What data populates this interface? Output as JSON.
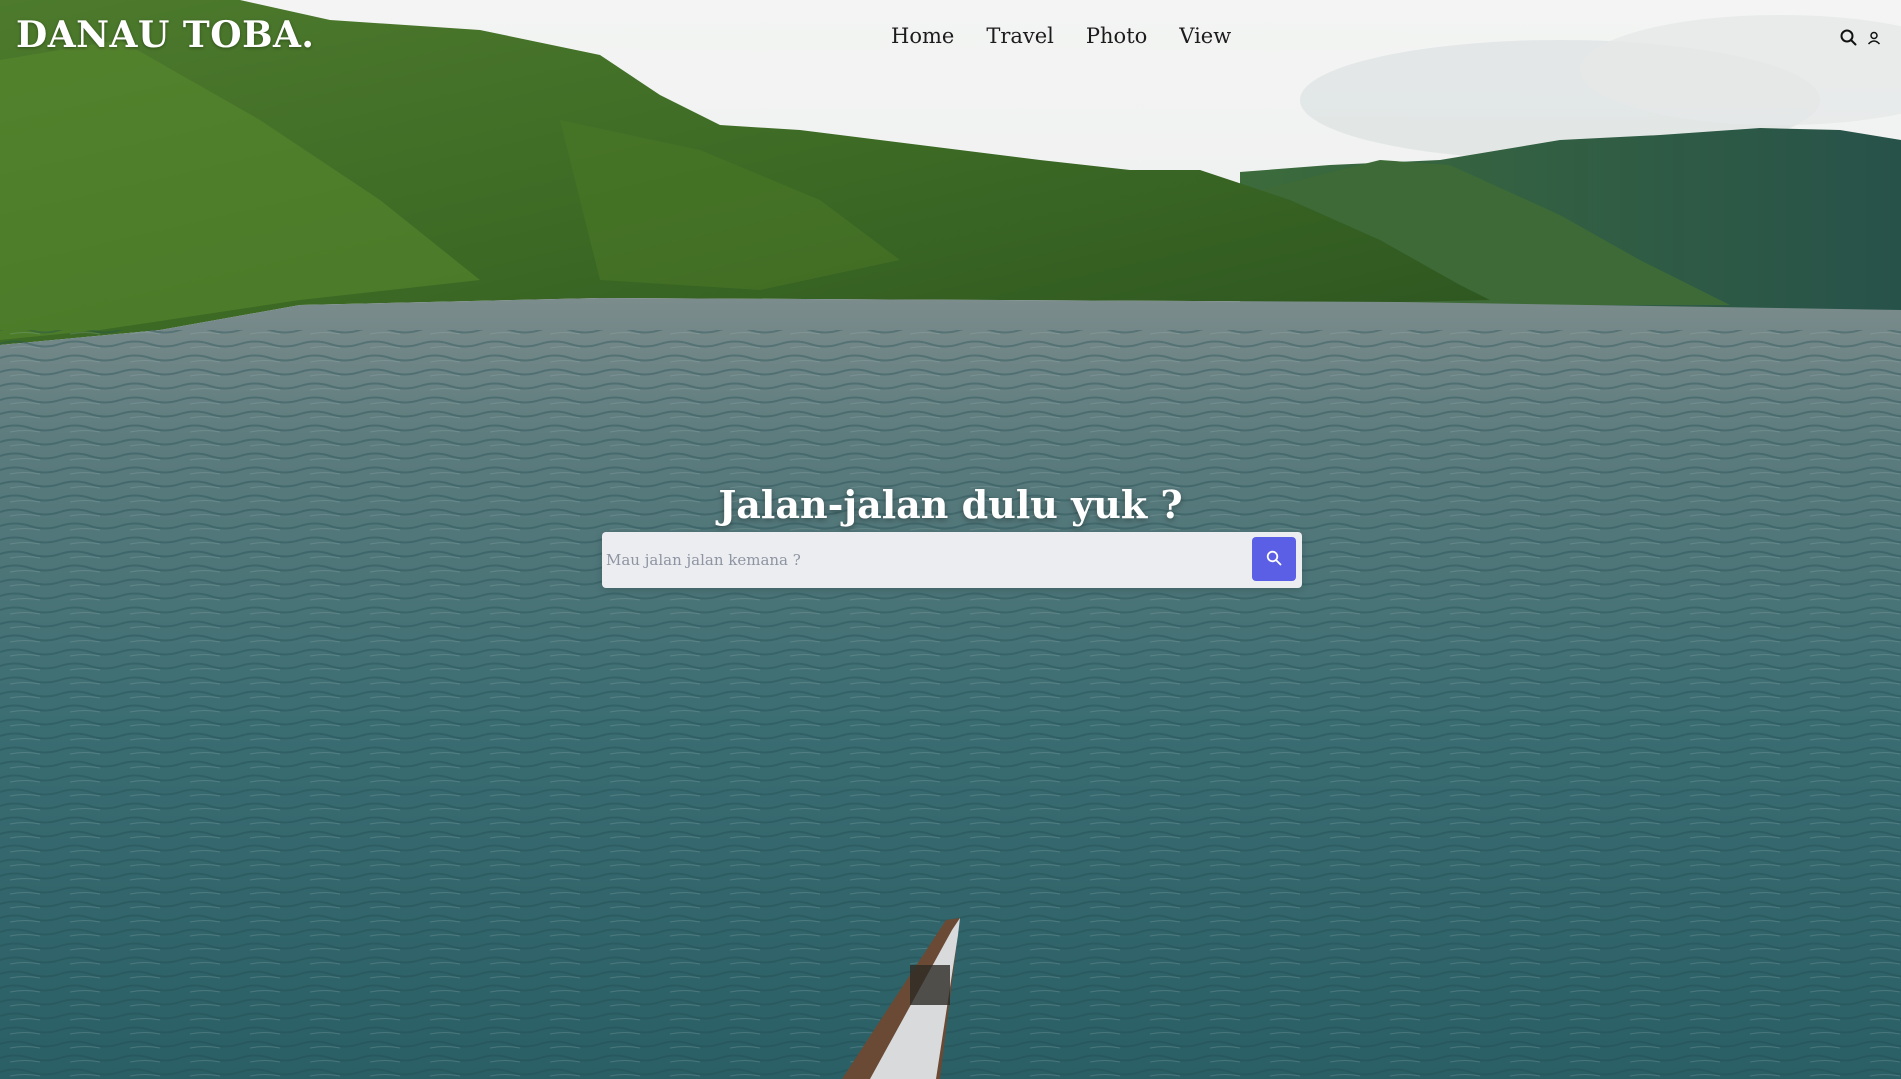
{
  "brand": {
    "logo": "DANAU TOBA."
  },
  "nav": {
    "links": [
      {
        "label": "Home"
      },
      {
        "label": "Travel"
      },
      {
        "label": "Photo"
      },
      {
        "label": "View"
      }
    ],
    "icons": [
      "search-icon",
      "user-icon"
    ]
  },
  "hero": {
    "title": "Jalan-jalan dulu yuk ?",
    "search": {
      "placeholder": "Mau jalan jalan kemana ?",
      "value": "",
      "button_icon": "search-icon"
    }
  },
  "colors": {
    "accent": "#5b5fe6",
    "water": "#2f6b72",
    "hills": "#3f6e2b",
    "sky": "#eef0ef"
  }
}
